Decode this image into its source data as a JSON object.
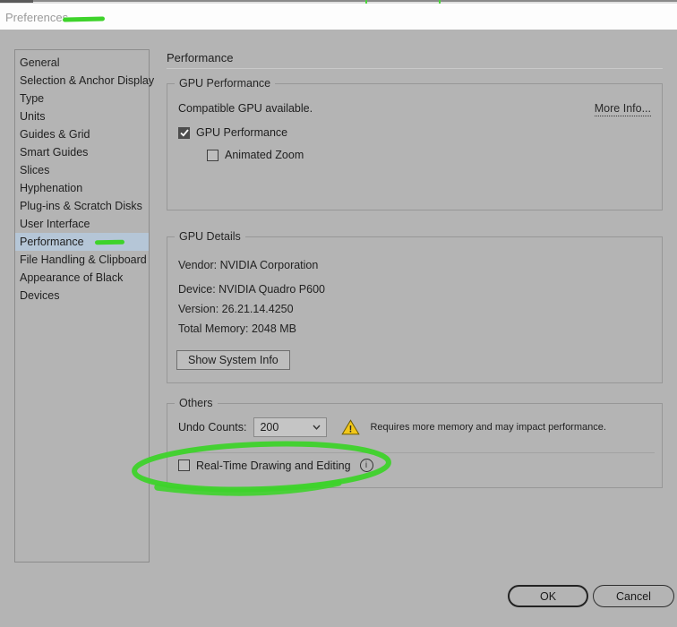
{
  "titlebar": {
    "title": "Preferences"
  },
  "sidebar": {
    "items": [
      "General",
      "Selection & Anchor Display",
      "Type",
      "Units",
      "Guides & Grid",
      "Smart Guides",
      "Slices",
      "Hyphenation",
      "Plug-ins & Scratch Disks",
      "User Interface",
      "Performance",
      "File Handling & Clipboard",
      "Appearance of Black",
      "Devices"
    ],
    "selected_item": "Performance"
  },
  "main": {
    "heading": "Performance",
    "gpu_performance": {
      "legend": "GPU Performance",
      "status_text": "Compatible GPU available.",
      "more_info_label": "More Info...",
      "gpu_performance_checkbox": {
        "label": "GPU Performance",
        "checked": true
      },
      "animated_zoom_checkbox": {
        "label": "Animated Zoom",
        "checked": false
      }
    },
    "gpu_details": {
      "legend": "GPU Details",
      "vendor": "Vendor: NVIDIA Corporation",
      "device": "Device: NVIDIA Quadro P600",
      "version": "Version: 26.21.14.4250",
      "total_memory": "Total Memory: 2048 MB",
      "show_system_info_label": "Show System Info"
    },
    "others": {
      "legend": "Others",
      "undo_counts_label": "Undo Counts:",
      "undo_counts_value": "200",
      "warning_text": "Requires more memory and may impact performance.",
      "realtime_checkbox": {
        "label": "Real-Time Drawing and Editing",
        "checked": false
      }
    }
  },
  "footer": {
    "ok_label": "OK",
    "cancel_label": "Cancel"
  },
  "icons": {
    "warning_mark": "!",
    "info_mark": "i"
  },
  "annotations": {
    "color": "#3ed32b",
    "marks": [
      "underline-after-preferences-title",
      "underline-after-performance-sidebar-item",
      "circle-around-realtime-checkbox",
      "tick-top-left",
      "tick-top-right"
    ]
  }
}
